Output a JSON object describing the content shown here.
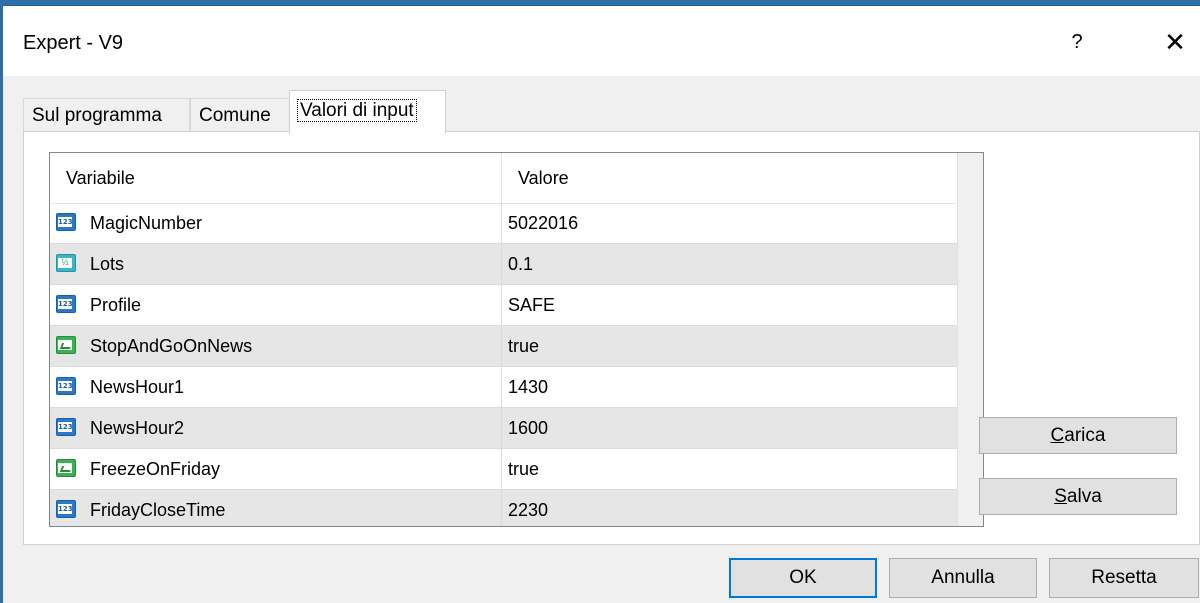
{
  "window": {
    "title": "Expert - V9",
    "help_glyph": "?",
    "close_glyph": "✕"
  },
  "tabs": [
    {
      "label": "Sul programma",
      "active": false
    },
    {
      "label": "Comune",
      "active": false
    },
    {
      "label": "Valori di input",
      "active": true
    }
  ],
  "grid": {
    "headers": [
      "Variabile",
      "Valore"
    ],
    "rows": [
      {
        "type_icon": "int-type-icon",
        "name": "MagicNumber",
        "value": "5022016"
      },
      {
        "type_icon": "double-type-icon",
        "name": "Lots",
        "value": "0.1"
      },
      {
        "type_icon": "int-type-icon",
        "name": "Profile",
        "value": "SAFE"
      },
      {
        "type_icon": "bool-type-icon",
        "name": "StopAndGoOnNews",
        "value": "true"
      },
      {
        "type_icon": "int-type-icon",
        "name": "NewsHour1",
        "value": "1430"
      },
      {
        "type_icon": "int-type-icon",
        "name": "NewsHour2",
        "value": "1600"
      },
      {
        "type_icon": "bool-type-icon",
        "name": "FreezeOnFriday",
        "value": "true"
      },
      {
        "type_icon": "int-type-icon",
        "name": "FridayCloseTime",
        "value": "2230"
      }
    ]
  },
  "side_buttons": {
    "load": {
      "accel": "C",
      "rest": "arica"
    },
    "save": {
      "accel": "S",
      "rest": "alva"
    }
  },
  "footer_buttons": {
    "ok": "OK",
    "cancel": "Annulla",
    "reset": "Resetta"
  }
}
